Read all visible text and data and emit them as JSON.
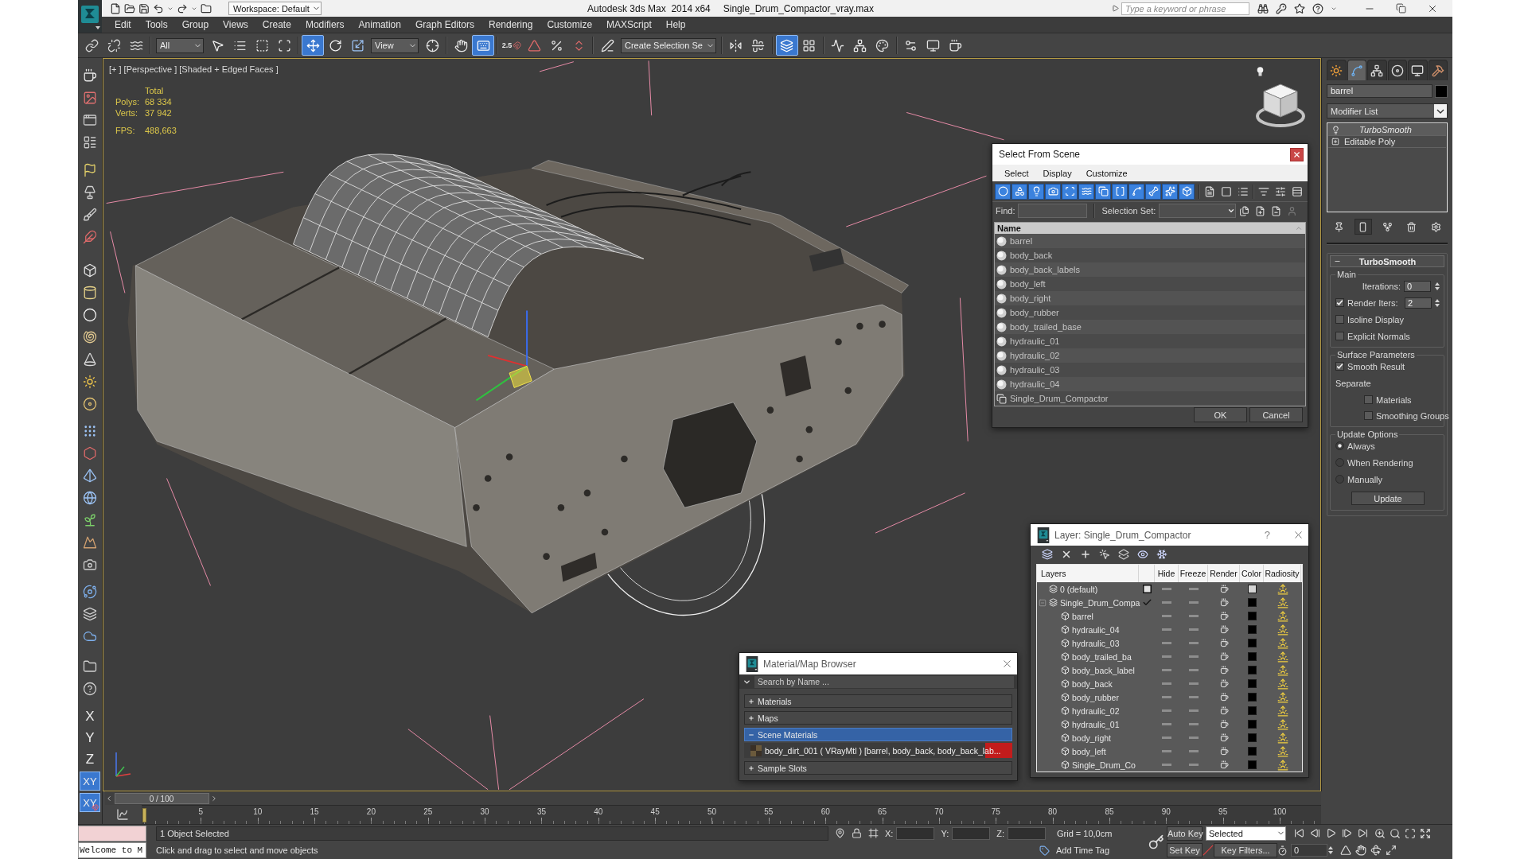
{
  "title_bar": {
    "workspace": "Workspace: Default",
    "app": "Autodesk 3ds Max  2014 x64",
    "file": "Single_Drum_Compactor_vray.max",
    "search_placeholder": "Type a keyword or phrase"
  },
  "menu": [
    "Edit",
    "Tools",
    "Group",
    "Views",
    "Create",
    "Modifiers",
    "Animation",
    "Graph Editors",
    "Rendering",
    "Customize",
    "MAXScript",
    "Help"
  ],
  "main_toolbar": [
    [
      {
        "kind": "tool",
        "selected": false
      },
      {
        "kind": "tool",
        "selected": false
      },
      {
        "kind": "tool",
        "selected": false
      }
    ],
    [
      {
        "kind": "dropdown",
        "value": "All"
      },
      {
        "kind": "tool",
        "selected": false
      },
      {
        "kind": "tool",
        "selected": false
      },
      {
        "kind": "tool",
        "selected": false
      },
      {
        "kind": "tool",
        "selected": false
      }
    ],
    [
      {
        "kind": "tool",
        "selected": true
      },
      {
        "kind": "tool",
        "selected": false
      },
      {
        "kind": "tool",
        "selected": false
      },
      {
        "kind": "dropdown",
        "value": "View"
      },
      {
        "kind": "tool",
        "selected": false
      }
    ],
    [
      {
        "kind": "tool",
        "selected": false
      },
      {
        "kind": "tool",
        "selected": true
      }
    ],
    [
      {
        "kind": "tool",
        "selected": false,
        "label": "2.5"
      },
      {
        "kind": "tool",
        "selected": false
      },
      {
        "kind": "tool",
        "selected": false
      },
      {
        "kind": "tool",
        "selected": false
      }
    ],
    [
      {
        "kind": "tool",
        "selected": false
      },
      {
        "kind": "dropdown",
        "value": "Create Selection Se"
      }
    ],
    [
      {
        "kind": "tool",
        "selected": false
      },
      {
        "kind": "tool",
        "selected": false
      }
    ],
    [
      {
        "kind": "tool",
        "selected": true
      },
      {
        "kind": "tool",
        "selected": false
      }
    ],
    [
      {
        "kind": "tool",
        "selected": false
      },
      {
        "kind": "tool",
        "selected": false
      },
      {
        "kind": "tool",
        "selected": false
      }
    ],
    [
      {
        "kind": "tool",
        "selected": false
      },
      {
        "kind": "tool",
        "selected": false
      },
      {
        "kind": "tool",
        "selected": false
      }
    ]
  ],
  "axes": [
    {
      "label": "X",
      "kind": "axis",
      "selected": false
    },
    {
      "label": "Y",
      "kind": "axis",
      "selected": false
    },
    {
      "label": "Z",
      "kind": "axis",
      "selected": false
    },
    {
      "label": "XY",
      "kind": "axis",
      "selected": true
    },
    {
      "label": "XY",
      "kind": "axis-snap",
      "selected": true
    }
  ],
  "viewport": {
    "labels": [
      "[+ ]",
      "[Perspective ]",
      "[Shaded + Edged Faces ]"
    ],
    "stats_header": "Total",
    "stats": [
      {
        "label": "Polys:",
        "value": "68 334"
      },
      {
        "label": "Verts:",
        "value": "37 942"
      }
    ],
    "fps": {
      "label": "FPS:",
      "value": "488,663"
    }
  },
  "command_panel": {
    "tabs": [
      {
        "selected": false
      },
      {
        "selected": true
      },
      {
        "selected": false
      },
      {
        "selected": false
      },
      {
        "selected": false
      },
      {
        "selected": false
      }
    ],
    "object_name": "barrel",
    "modifier_list": "Modifier List",
    "stack": [
      {
        "name": "TurboSmooth",
        "kind": "modifier",
        "enabled": true,
        "instanced": true,
        "selected": true
      },
      {
        "name": "Editable Poly",
        "kind": "base",
        "expanded": false,
        "instanced": false,
        "selected": false
      }
    ],
    "stack_tools": [
      {
        "selected": false
      },
      {
        "selected": true
      },
      {
        "selected": false
      },
      {
        "selected": false
      },
      {
        "selected": false
      }
    ],
    "rollout": {
      "title": "TurboSmooth",
      "expanded": true,
      "groups": [
        {
          "title": "Main",
          "controls": [
            {
              "kind": "spinner",
              "label": "Iterations:",
              "value": "0"
            },
            {
              "kind": "check-spinner",
              "label": "Render Iters:",
              "value": "2",
              "checked": true
            },
            {
              "kind": "checkbox",
              "label": "Isoline Display",
              "checked": false
            },
            {
              "kind": "checkbox",
              "label": "Explicit Normals",
              "checked": false
            }
          ]
        },
        {
          "title": "Surface Parameters",
          "controls": [
            {
              "kind": "checkbox",
              "label": "Smooth Result",
              "checked": true
            },
            {
              "kind": "label",
              "label": "Separate",
              "children": [
                {
                  "kind": "checkbox",
                  "label": "Materials",
                  "checked": false
                },
                {
                  "kind": "checkbox",
                  "label": "Smoothing Groups",
                  "checked": false
                }
              ]
            }
          ]
        },
        {
          "title": "Update Options",
          "controls": [
            {
              "kind": "radio",
              "label": "Always",
              "selected": true
            },
            {
              "kind": "radio",
              "label": "When Rendering",
              "selected": false
            },
            {
              "kind": "radio",
              "label": "Manually",
              "selected": false
            },
            {
              "kind": "button",
              "label": "Update"
            }
          ]
        }
      ]
    }
  },
  "select_dialog": {
    "title": "Select From Scene",
    "menu": [
      "Select",
      "Display",
      "Customize"
    ],
    "filters": [
      {
        "on": true
      },
      {
        "on": true
      },
      {
        "on": true
      },
      {
        "on": true
      },
      {
        "on": true
      },
      {
        "on": true
      },
      {
        "on": true
      },
      {
        "on": true
      },
      {
        "on": true
      },
      {
        "on": true
      },
      {
        "on": true
      },
      {
        "on": true
      }
    ],
    "find_label": "Find:",
    "selection_set_label": "Selection Set:",
    "column": "Name",
    "rows": [
      {
        "name": "barrel",
        "kind": "object",
        "selected": false
      },
      {
        "name": "body_back",
        "kind": "object",
        "selected": false
      },
      {
        "name": "body_back_labels",
        "kind": "object",
        "selected": false
      },
      {
        "name": "body_left",
        "kind": "object",
        "selected": false
      },
      {
        "name": "body_right",
        "kind": "object",
        "selected": false
      },
      {
        "name": "body_rubber",
        "kind": "object",
        "selected": false
      },
      {
        "name": "body_trailed_base",
        "kind": "object",
        "selected": false
      },
      {
        "name": "hydraulic_01",
        "kind": "object",
        "selected": false
      },
      {
        "name": "hydraulic_02",
        "kind": "object",
        "selected": false
      },
      {
        "name": "hydraulic_03",
        "kind": "object",
        "selected": false
      },
      {
        "name": "hydraulic_04",
        "kind": "object",
        "selected": false
      },
      {
        "name": "Single_Drum_Compactor",
        "kind": "group",
        "selected": false
      }
    ],
    "buttons": [
      "OK",
      "Cancel"
    ]
  },
  "layer_dialog": {
    "title": "Layer: Single_Drum_Compactor",
    "help": "?",
    "columns": [
      "Layers",
      "Hide",
      "Freeze",
      "Render",
      "Color",
      "Radiosity"
    ],
    "layers": [
      {
        "name": "0 (default)",
        "kind": "layer",
        "current": false,
        "hide": false,
        "freeze": false,
        "render": true,
        "color": "#d4d4d4"
      },
      {
        "name": "Single_Drum_Compa",
        "kind": "layer",
        "current": true,
        "expanded": true,
        "hide": false,
        "freeze": false,
        "render": true,
        "color": "#000000",
        "children": [
          {
            "name": "barrel",
            "kind": "object",
            "hide": false,
            "freeze": false,
            "render": true,
            "color": "#000000"
          },
          {
            "name": "hydraulic_04",
            "kind": "object",
            "hide": false,
            "freeze": false,
            "render": true,
            "color": "#000000"
          },
          {
            "name": "hydraulic_03",
            "kind": "object",
            "hide": false,
            "freeze": false,
            "render": true,
            "color": "#000000"
          },
          {
            "name": "body_trailed_ba",
            "kind": "object",
            "hide": false,
            "freeze": false,
            "render": true,
            "color": "#000000"
          },
          {
            "name": "body_back_label",
            "kind": "object",
            "hide": false,
            "freeze": false,
            "render": true,
            "color": "#000000"
          },
          {
            "name": "body_back",
            "kind": "object",
            "hide": false,
            "freeze": false,
            "render": true,
            "color": "#000000"
          },
          {
            "name": "body_rubber",
            "kind": "object",
            "hide": false,
            "freeze": false,
            "render": true,
            "color": "#000000"
          },
          {
            "name": "hydraulic_02",
            "kind": "object",
            "hide": false,
            "freeze": false,
            "render": true,
            "color": "#000000"
          },
          {
            "name": "hydraulic_01",
            "kind": "object",
            "hide": false,
            "freeze": false,
            "render": true,
            "color": "#000000"
          },
          {
            "name": "body_right",
            "kind": "object",
            "hide": false,
            "freeze": false,
            "render": true,
            "color": "#000000"
          },
          {
            "name": "body_left",
            "kind": "object",
            "hide": false,
            "freeze": false,
            "render": true,
            "color": "#000000"
          },
          {
            "name": "Single_Drum_Co",
            "kind": "object",
            "hide": false,
            "freeze": false,
            "render": true,
            "color": "#000000"
          }
        ]
      }
    ]
  },
  "material_browser": {
    "title": "Material/Map Browser",
    "search_placeholder": "Search by Name ...",
    "sections": [
      {
        "title": "Materials",
        "expanded": false,
        "selected": false
      },
      {
        "title": "Maps",
        "expanded": false,
        "selected": false
      },
      {
        "title": "Scene Materials",
        "expanded": true,
        "selected": true,
        "items": [
          "body_dirt_001 ( VRayMtl ) [barrel, body_back, body_back_lab..."
        ]
      },
      {
        "title": "Sample Slots",
        "expanded": false,
        "selected": false
      }
    ]
  },
  "timeline": {
    "slider": "0 / 100",
    "level": 0,
    "ticks": [
      "5",
      "10",
      "15",
      "20",
      "25",
      "30",
      "35",
      "40",
      "45",
      "50",
      "55",
      "60",
      "65",
      "70",
      "75",
      "80",
      "85",
      "90",
      "95",
      "100"
    ]
  },
  "status": {
    "selection": "1 Object Selected",
    "prompt": "Click and drag to select and move objects",
    "listener": "Welcome to M",
    "coords": [
      "X:",
      "Y:",
      "Z:"
    ],
    "grid": "Grid = 10,0cm",
    "time_tag": "Add Time Tag",
    "auto_key": {
      "label": "Auto Key",
      "on": false
    },
    "key_mode": "Selected",
    "set_key": "Set Key",
    "key_filters": "Key Filters...",
    "frame": "0"
  }
}
